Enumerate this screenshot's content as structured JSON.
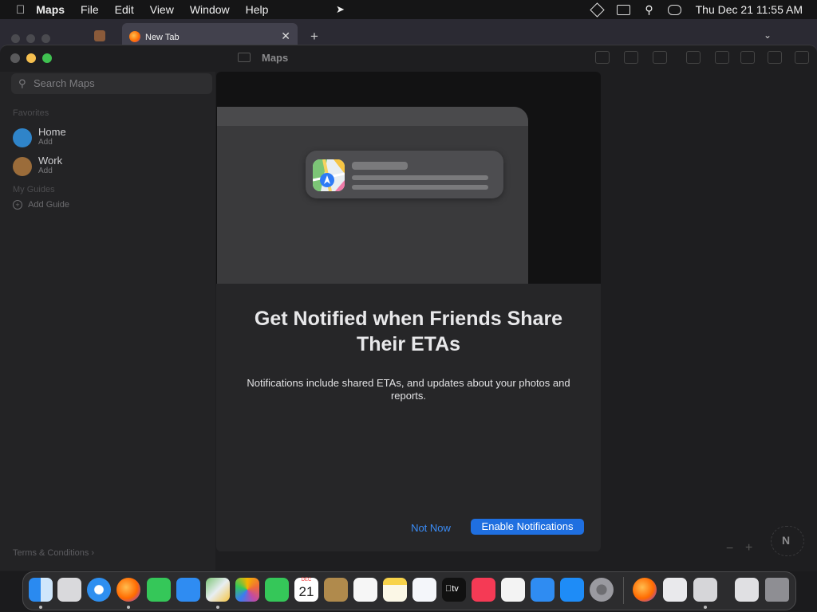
{
  "menubar": {
    "app": "Maps",
    "items": [
      "File",
      "Edit",
      "View",
      "Window",
      "Help"
    ],
    "clock": "Thu Dec 21  11:55 AM"
  },
  "browser_tab": {
    "label": "New Tab"
  },
  "window": {
    "title": "Maps"
  },
  "sidebar": {
    "search_placeholder": "Search Maps",
    "favorites_header": "Favorites",
    "favorites": [
      {
        "name": "Home",
        "sub": "Add"
      },
      {
        "name": "Work",
        "sub": "Add"
      }
    ],
    "guides_header": "My Guides",
    "add_guide": "Add Guide",
    "terms": "Terms & Conditions"
  },
  "modal": {
    "title": "Get Notified when Friends Share Their ETAs",
    "body": "Notifications include shared ETAs, and updates about your photos and reports.",
    "secondary_button": "Not Now",
    "primary_button": "Enable Notifications"
  },
  "compass": "N",
  "dock": {
    "calendar_month": "DEC",
    "calendar_day": "21",
    "tv_label": "tv"
  },
  "colors": {
    "accent": "#1f6fe0",
    "link": "#3a8cf7"
  }
}
